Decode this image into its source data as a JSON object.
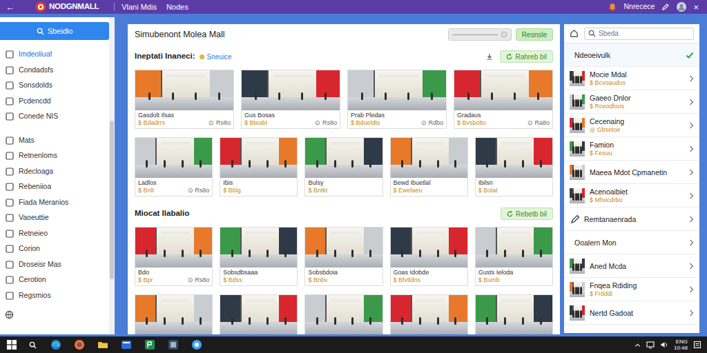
{
  "topbar": {
    "back": "←",
    "logo": "NODGNMALL",
    "nav": [
      "Vlani Mdis",
      "Nodes"
    ],
    "user": "Nnrecece",
    "close": "×"
  },
  "sidebar": {
    "search_button": "Sbeidlo",
    "groups": [
      {
        "items": [
          {
            "label": "Imdeoliuaf",
            "selected": true
          },
          {
            "label": "Condadsfs",
            "selected": false
          },
          {
            "label": "Sonsdolds",
            "selected": false
          },
          {
            "label": "Pcdencdd",
            "selected": false
          },
          {
            "label": "Conede NIS",
            "selected": false
          }
        ]
      },
      {
        "items": [
          {
            "label": "Mats",
            "selected": false
          },
          {
            "label": "Retnenloms",
            "selected": false
          },
          {
            "label": "Rdecloaga",
            "selected": false
          },
          {
            "label": "Rebeniioa",
            "selected": false
          },
          {
            "label": "Fiada Meranios",
            "selected": false
          },
          {
            "label": "Vaoeuttie",
            "selected": false
          },
          {
            "label": "Retneieo",
            "selected": false
          },
          {
            "label": "Corion",
            "selected": false
          },
          {
            "label": "Droseisr Mas",
            "selected": false
          },
          {
            "label": "Cerotion",
            "selected": false
          },
          {
            "label": "Regsmios",
            "selected": false
          }
        ]
      }
    ]
  },
  "main": {
    "title": "Simubenont Molea Mall",
    "search_button": "Resnsle",
    "sections": [
      {
        "title": "Ineptati Inaneci:",
        "tag": "Sneuice",
        "button": "Rahreb bil",
        "rows": [
          [
            {
              "kind": "card",
              "caption": "Gasdolt Ilsas",
              "price": "$ Bdadrrs",
              "rating": "⊙ Rs8o"
            },
            {
              "kind": "card",
              "caption": "Gus Bosas",
              "price": "$ Bteabl",
              "rating": "⊙ Rs8o"
            },
            {
              "kind": "card",
              "caption": "Prab Pledas",
              "price": "$ Bdoeldts",
              "rating": "⊙ Rdbo"
            },
            {
              "kind": "card",
              "caption": "Gradaus",
              "price": "$ Bvsbolto",
              "rating": "⊙ Ra8o"
            }
          ],
          [
            {
              "kind": "card",
              "caption": "Ladlos",
              "price": "$ Bnlt",
              "rating": "⊙ Rs8o"
            },
            {
              "kind": "card",
              "caption": "Ibis",
              "price": "$ Bblg",
              "rating": ""
            },
            {
              "kind": "card",
              "caption": "Bulsy",
              "price": "$ Bntkt",
              "rating": ""
            },
            {
              "kind": "card",
              "caption": "Bewd Ibuetlal",
              "price": "$ Ewelaeu",
              "rating": ""
            },
            {
              "kind": "card",
              "caption": "Ibilsn",
              "price": "$ Bolat",
              "rating": ""
            }
          ]
        ]
      },
      {
        "title": "Miocat Ilabalio",
        "tag": "",
        "button": "Rebetb bil",
        "rows": [
          [
            {
              "kind": "card",
              "caption": "Bdo",
              "price": "$ Bpr",
              "rating": "⊙ Rs8o"
            },
            {
              "kind": "card",
              "caption": "Sobsdbsaaa",
              "price": "$ Bdss",
              "rating": ""
            },
            {
              "kind": "card",
              "caption": "Sobsbdoia",
              "price": "$ Bnbv",
              "rating": ""
            },
            {
              "kind": "card",
              "caption": "Goas Idobde",
              "price": "$ Bfvtldns",
              "rating": ""
            },
            {
              "kind": "card",
              "caption": "Gusts Ieloda",
              "price": "$ Bumb",
              "rating": ""
            }
          ],
          [
            {
              "kind": "photo"
            },
            {
              "kind": "photo"
            },
            {
              "kind": "photo"
            },
            {
              "kind": "photo"
            },
            {
              "kind": "photo"
            }
          ]
        ]
      }
    ]
  },
  "right_panel": {
    "search": {
      "placeholder": "Sbeda"
    },
    "items": [
      {
        "kind": "plain",
        "title": "Ndeoeivulk",
        "sub": "",
        "selected": true
      },
      {
        "kind": "thumb",
        "title": "Mocie Mdal",
        "sub": "$ Bcvoaudus",
        "selected": false
      },
      {
        "kind": "thumb",
        "title": "Gaeeo Dnlor",
        "sub": "$ Rceodloos",
        "selected": false
      },
      {
        "kind": "thumb",
        "title": "Cecenaing",
        "sub": "◎ Gbsetoe",
        "selected": false
      },
      {
        "kind": "thumb",
        "title": "Famion",
        "sub": "$ Fesuu",
        "selected": false
      },
      {
        "kind": "thumb",
        "title": "Maeea Mdot Cpmanetin",
        "sub": "",
        "selected": false
      },
      {
        "kind": "thumb",
        "title": "Acenoaibiet",
        "sub": "$ Mhocdrbo",
        "selected": false
      },
      {
        "kind": "edit",
        "title": "Remtanaenrada",
        "sub": "",
        "selected": false
      },
      {
        "kind": "plain",
        "title": "Ooalern Mon",
        "sub": "",
        "selected": false
      },
      {
        "kind": "thumb",
        "title": "Aned Mcda",
        "sub": "",
        "selected": false
      },
      {
        "kind": "thumb",
        "title": "Fnqea Rdiding",
        "sub": "$ Frdddi",
        "selected": false
      },
      {
        "kind": "thumb",
        "title": "Nertd Gadoat",
        "sub": "",
        "selected": false
      }
    ]
  },
  "taskbar": {
    "tray": [
      "ENG",
      "10:48"
    ]
  }
}
